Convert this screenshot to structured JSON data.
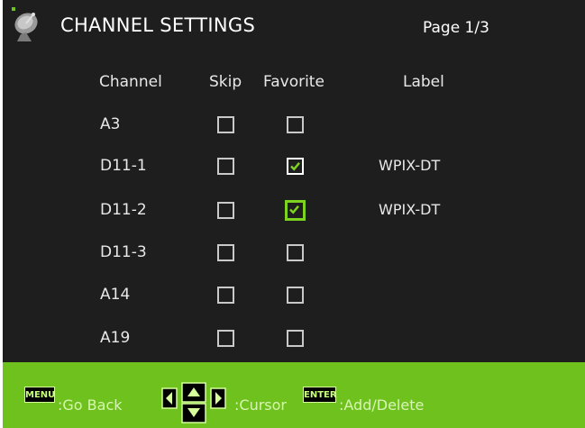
{
  "header": {
    "title": "CHANNEL SETTINGS",
    "page_indicator": "Page 1/3"
  },
  "columns": {
    "channel": "Channel",
    "skip": "Skip",
    "favorite": "Favorite",
    "label": "Label"
  },
  "rows": [
    {
      "channel": "A3",
      "skip": false,
      "favorite": false,
      "label": ""
    },
    {
      "channel": "D11-1",
      "skip": false,
      "favorite": true,
      "label": "WPIX-DT"
    },
    {
      "channel": "D11-2",
      "skip": false,
      "favorite": true,
      "label": "WPIX-DT",
      "focused": "favorite"
    },
    {
      "channel": "D11-3",
      "skip": false,
      "favorite": false,
      "label": ""
    },
    {
      "channel": "A14",
      "skip": false,
      "favorite": false,
      "label": ""
    },
    {
      "channel": "A19",
      "skip": false,
      "favorite": false,
      "label": ""
    }
  ],
  "footer": {
    "menu_key": "MENU",
    "menu_action": ":Go Back",
    "arrows_action": ":Cursor",
    "enter_key": "ENTER",
    "enter_action": ":Add/Delete"
  },
  "colors": {
    "accent": "#6fc21d",
    "panel": "#1e1e1e",
    "focus": "#7ed321"
  },
  "icons": {
    "header": "satellite-dish-icon",
    "check": "checkmark-icon",
    "navigation": "arrow-keys-icon"
  }
}
